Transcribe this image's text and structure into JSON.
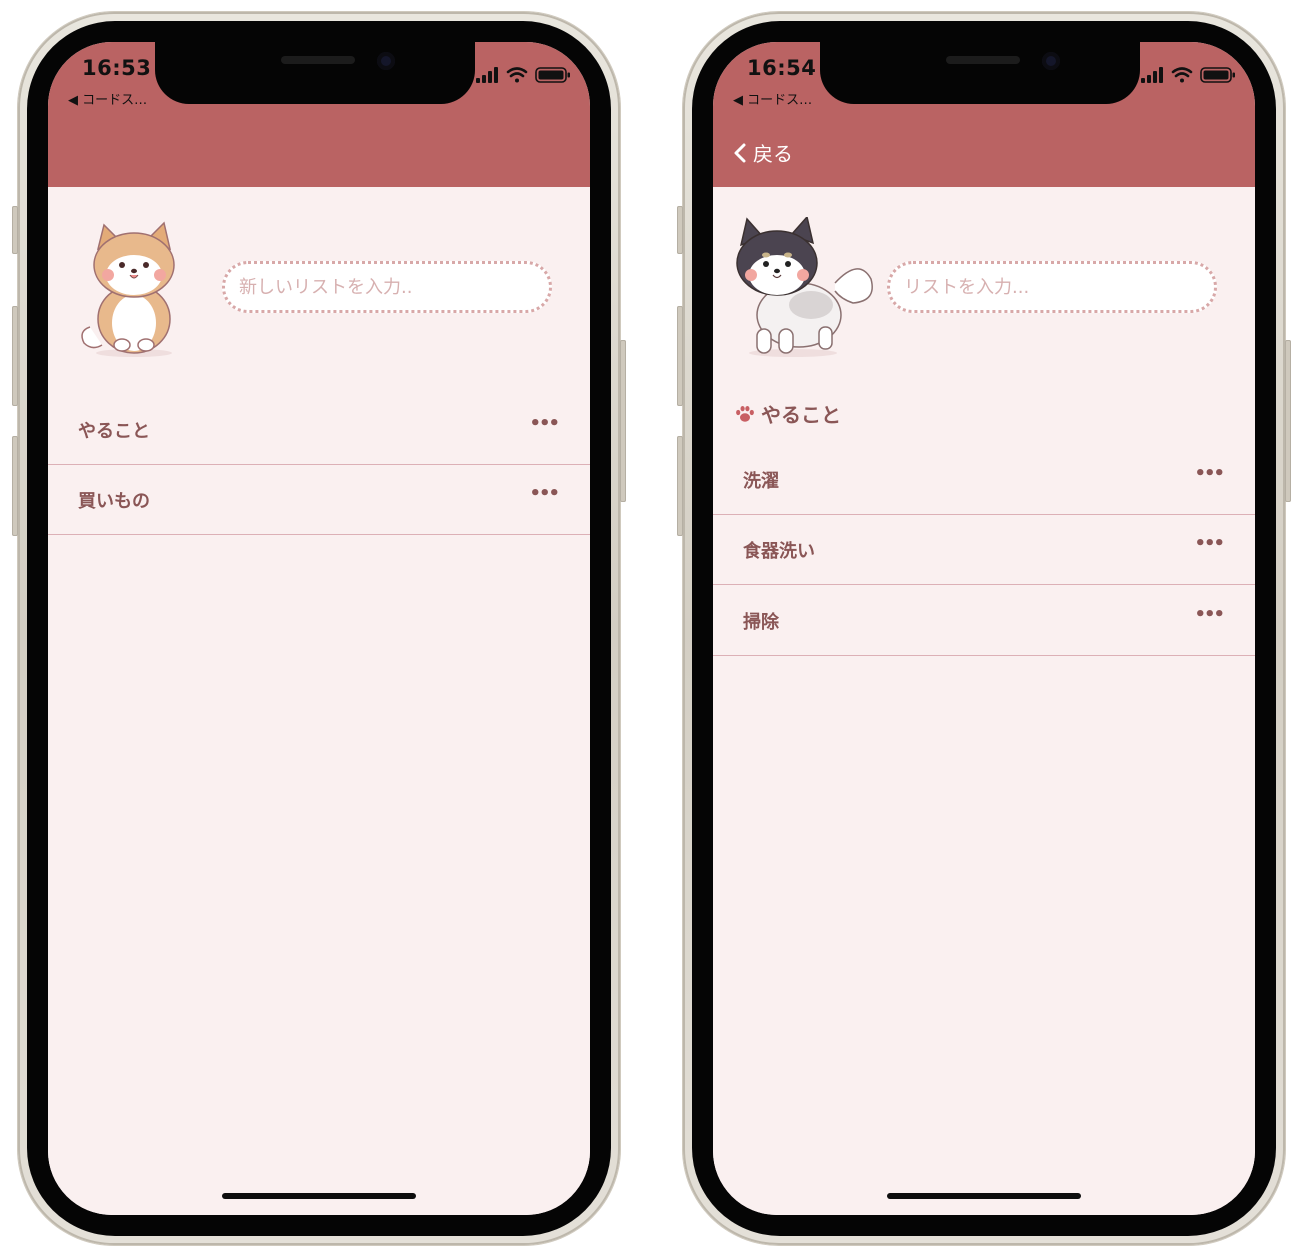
{
  "colors": {
    "nav_bar": "#ba6363",
    "background": "#faf0f0",
    "text": "#8a5656",
    "divider": "#dcb0b6",
    "placeholder": "#d7b0b0"
  },
  "left_screen": {
    "status": {
      "time": "16:53",
      "back_app": "◀ コードス…"
    },
    "dog_icon": "shiba-inu-tan-icon",
    "input_placeholder": "新しいリストを入力..",
    "lists": [
      {
        "label": "やること",
        "more": "•••"
      },
      {
        "label": "買いもの",
        "more": "•••"
      }
    ]
  },
  "right_screen": {
    "status": {
      "time": "16:54",
      "back_app": "◀ コードス…"
    },
    "back_label": "戻る",
    "dog_icon": "shiba-inu-black-icon",
    "input_placeholder": "リストを入力...",
    "section_title": "やること",
    "section_icon": "paw-icon",
    "items": [
      {
        "label": "洗濯",
        "more": "•••"
      },
      {
        "label": "食器洗い",
        "more": "•••"
      },
      {
        "label": "掃除",
        "more": "•••"
      }
    ]
  }
}
